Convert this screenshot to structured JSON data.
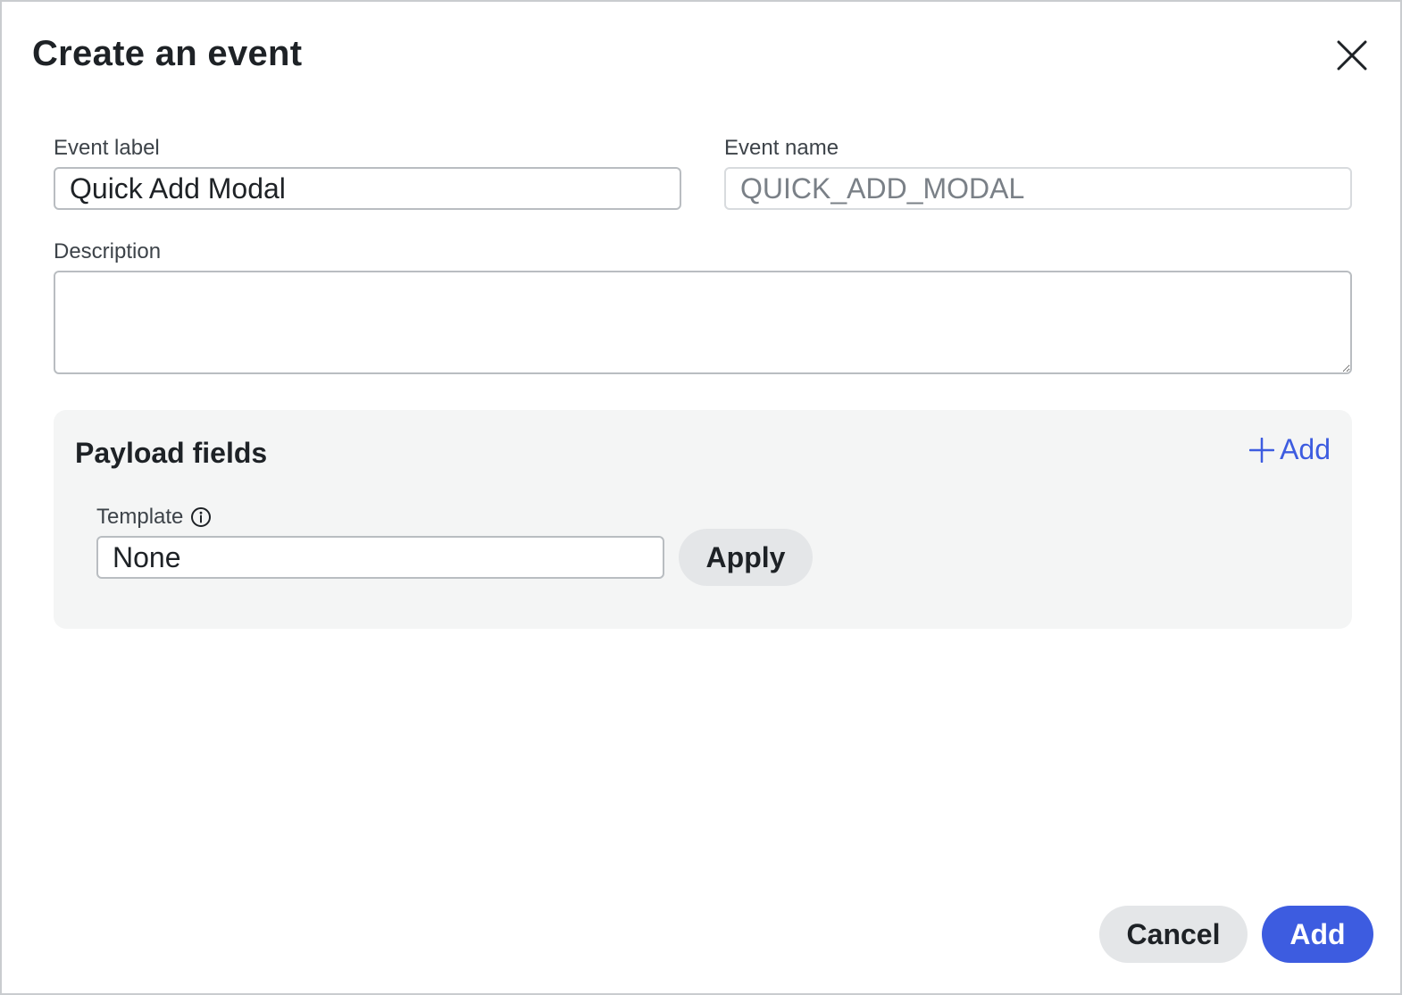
{
  "dialog": {
    "title": "Create an event",
    "close_icon": "close-icon"
  },
  "form": {
    "event_label": {
      "label": "Event label",
      "value": "Quick Add Modal"
    },
    "event_name": {
      "label": "Event name",
      "value": "QUICK_ADD_MODAL"
    },
    "description": {
      "label": "Description",
      "value": ""
    }
  },
  "payload": {
    "title": "Payload fields",
    "add_label": "Add",
    "add_icon": "plus-icon",
    "template": {
      "label": "Template",
      "info_icon": "info-icon",
      "value": "None"
    },
    "apply_label": "Apply"
  },
  "footer": {
    "cancel_label": "Cancel",
    "add_label": "Add"
  },
  "colors": {
    "primary": "#3d5ce0",
    "secondary_button": "#e4e6e8",
    "panel_bg": "#f4f5f5",
    "border": "#b9bdc1",
    "text": "#1e2226"
  }
}
